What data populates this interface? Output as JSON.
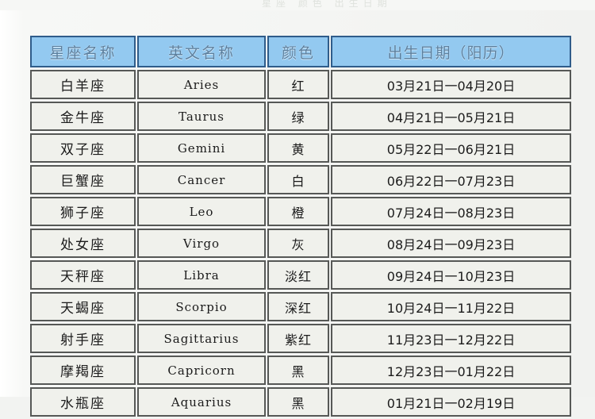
{
  "scan": {
    "top_cutoff_text": "星座 颜色 出生日期"
  },
  "table": {
    "headers": {
      "name": "星座名称",
      "english": "英文名称",
      "color": "颜色",
      "birthdate": "出生日期（阳历）"
    },
    "rows": [
      {
        "name": "白羊座",
        "english": "Aries",
        "color": "红",
        "birthdate": "03月21日一04月20日"
      },
      {
        "name": "金牛座",
        "english": "Taurus",
        "color": "绿",
        "birthdate": "04月21日一05月21日"
      },
      {
        "name": "双子座",
        "english": "Gemini",
        "color": "黄",
        "birthdate": "05月22日一06月21日"
      },
      {
        "name": "巨蟹座",
        "english": "Cancer",
        "color": "白",
        "birthdate": "06月22日一07月23日"
      },
      {
        "name": "狮子座",
        "english": "Leo",
        "color": "橙",
        "birthdate": "07月24日一08月23日"
      },
      {
        "name": "处女座",
        "english": "Virgo",
        "color": "灰",
        "birthdate": "08月24日一09月23日"
      },
      {
        "name": "天秤座",
        "english": "Libra",
        "color": "淡红",
        "birthdate": "09月24日一10月23日"
      },
      {
        "name": "天蝎座",
        "english": "Scorpio",
        "color": "深红",
        "birthdate": "10月24日一11月22日"
      },
      {
        "name": "射手座",
        "english": "Sagittarius",
        "color": "紫红",
        "birthdate": "11月23日一12月22日"
      },
      {
        "name": "摩羯座",
        "english": "Capricorn",
        "color": "黑",
        "birthdate": "12月23日一01月22日"
      },
      {
        "name": "水瓶座",
        "english": "Aquarius",
        "color": "黑",
        "birthdate": "01月21日一02月19日"
      }
    ]
  },
  "colors": {
    "header_fill": "#93c9f0",
    "header_border": "#2f5c8a",
    "header_text": "#5b7f9e",
    "cell_fill": "#f0f1ec",
    "cell_border": "#565856",
    "page_background": "#f2f3f1"
  }
}
